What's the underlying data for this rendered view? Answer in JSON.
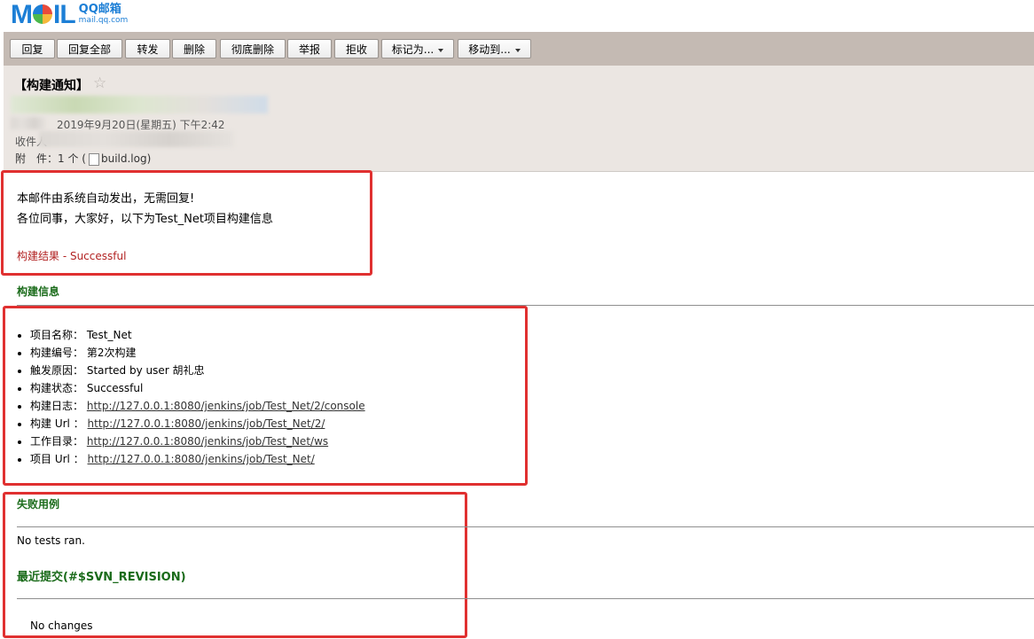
{
  "logo": {
    "brand": "MAIL",
    "line1": "QQ邮箱",
    "line2": "mail.qq.com"
  },
  "toolbar": {
    "reply": "回复",
    "reply_all": "回复全部",
    "forward": "转发",
    "delete": "删除",
    "delete_forever": "彻底删除",
    "report": "举报",
    "reject": "拒收",
    "mark_as": "标记为...",
    "move_to": "移动到..."
  },
  "header": {
    "subject": "【构建通知】",
    "star_icon": "star-outline-icon",
    "date": "2019年9月20日(星期五) 下午2:42",
    "recipients_label": "收件人",
    "attachment_label": "附　件：",
    "attachment_count": "1 个 (",
    "attachment_file": "build.log",
    "attachment_close": ")"
  },
  "email": {
    "auto_note": "本邮件由系统自动发出，无需回复!",
    "greeting": "各位同事，大家好，以下为Test_Net项目构建信息",
    "result": "构建结果 - Successful",
    "info_title": "构建信息",
    "info": [
      {
        "label": "项目名称：",
        "value": "Test_Net",
        "link": false
      },
      {
        "label": "构建编号：",
        "value": "第2次构建",
        "link": false
      },
      {
        "label": "触发原因：",
        "value": "Started by user 胡礼忠",
        "link": false
      },
      {
        "label": "构建状态：",
        "value": "Successful",
        "link": false
      },
      {
        "label": "构建日志：",
        "value": "http://127.0.0.1:8080/jenkins/job/Test_Net/2/console",
        "link": true
      },
      {
        "label": "构建 Url ：",
        "value": "http://127.0.0.1:8080/jenkins/job/Test_Net/2/",
        "link": true
      },
      {
        "label": "工作目录：",
        "value": "http://127.0.0.1:8080/jenkins/job/Test_Net/ws",
        "link": true
      },
      {
        "label": "项目 Url ：",
        "value": "http://127.0.0.1:8080/jenkins/job/Test_Net/",
        "link": true
      }
    ],
    "failed_title": "失败用例",
    "no_tests": "No tests ran.",
    "commits_title": "最近提交(#$SVN_REVISION)",
    "no_changes": "No changes"
  },
  "colors": {
    "accent_box": "#e03030",
    "section_green": "#1a6b1a",
    "result_red": "#b22222",
    "toolbar_bg": "#c4bab3"
  }
}
